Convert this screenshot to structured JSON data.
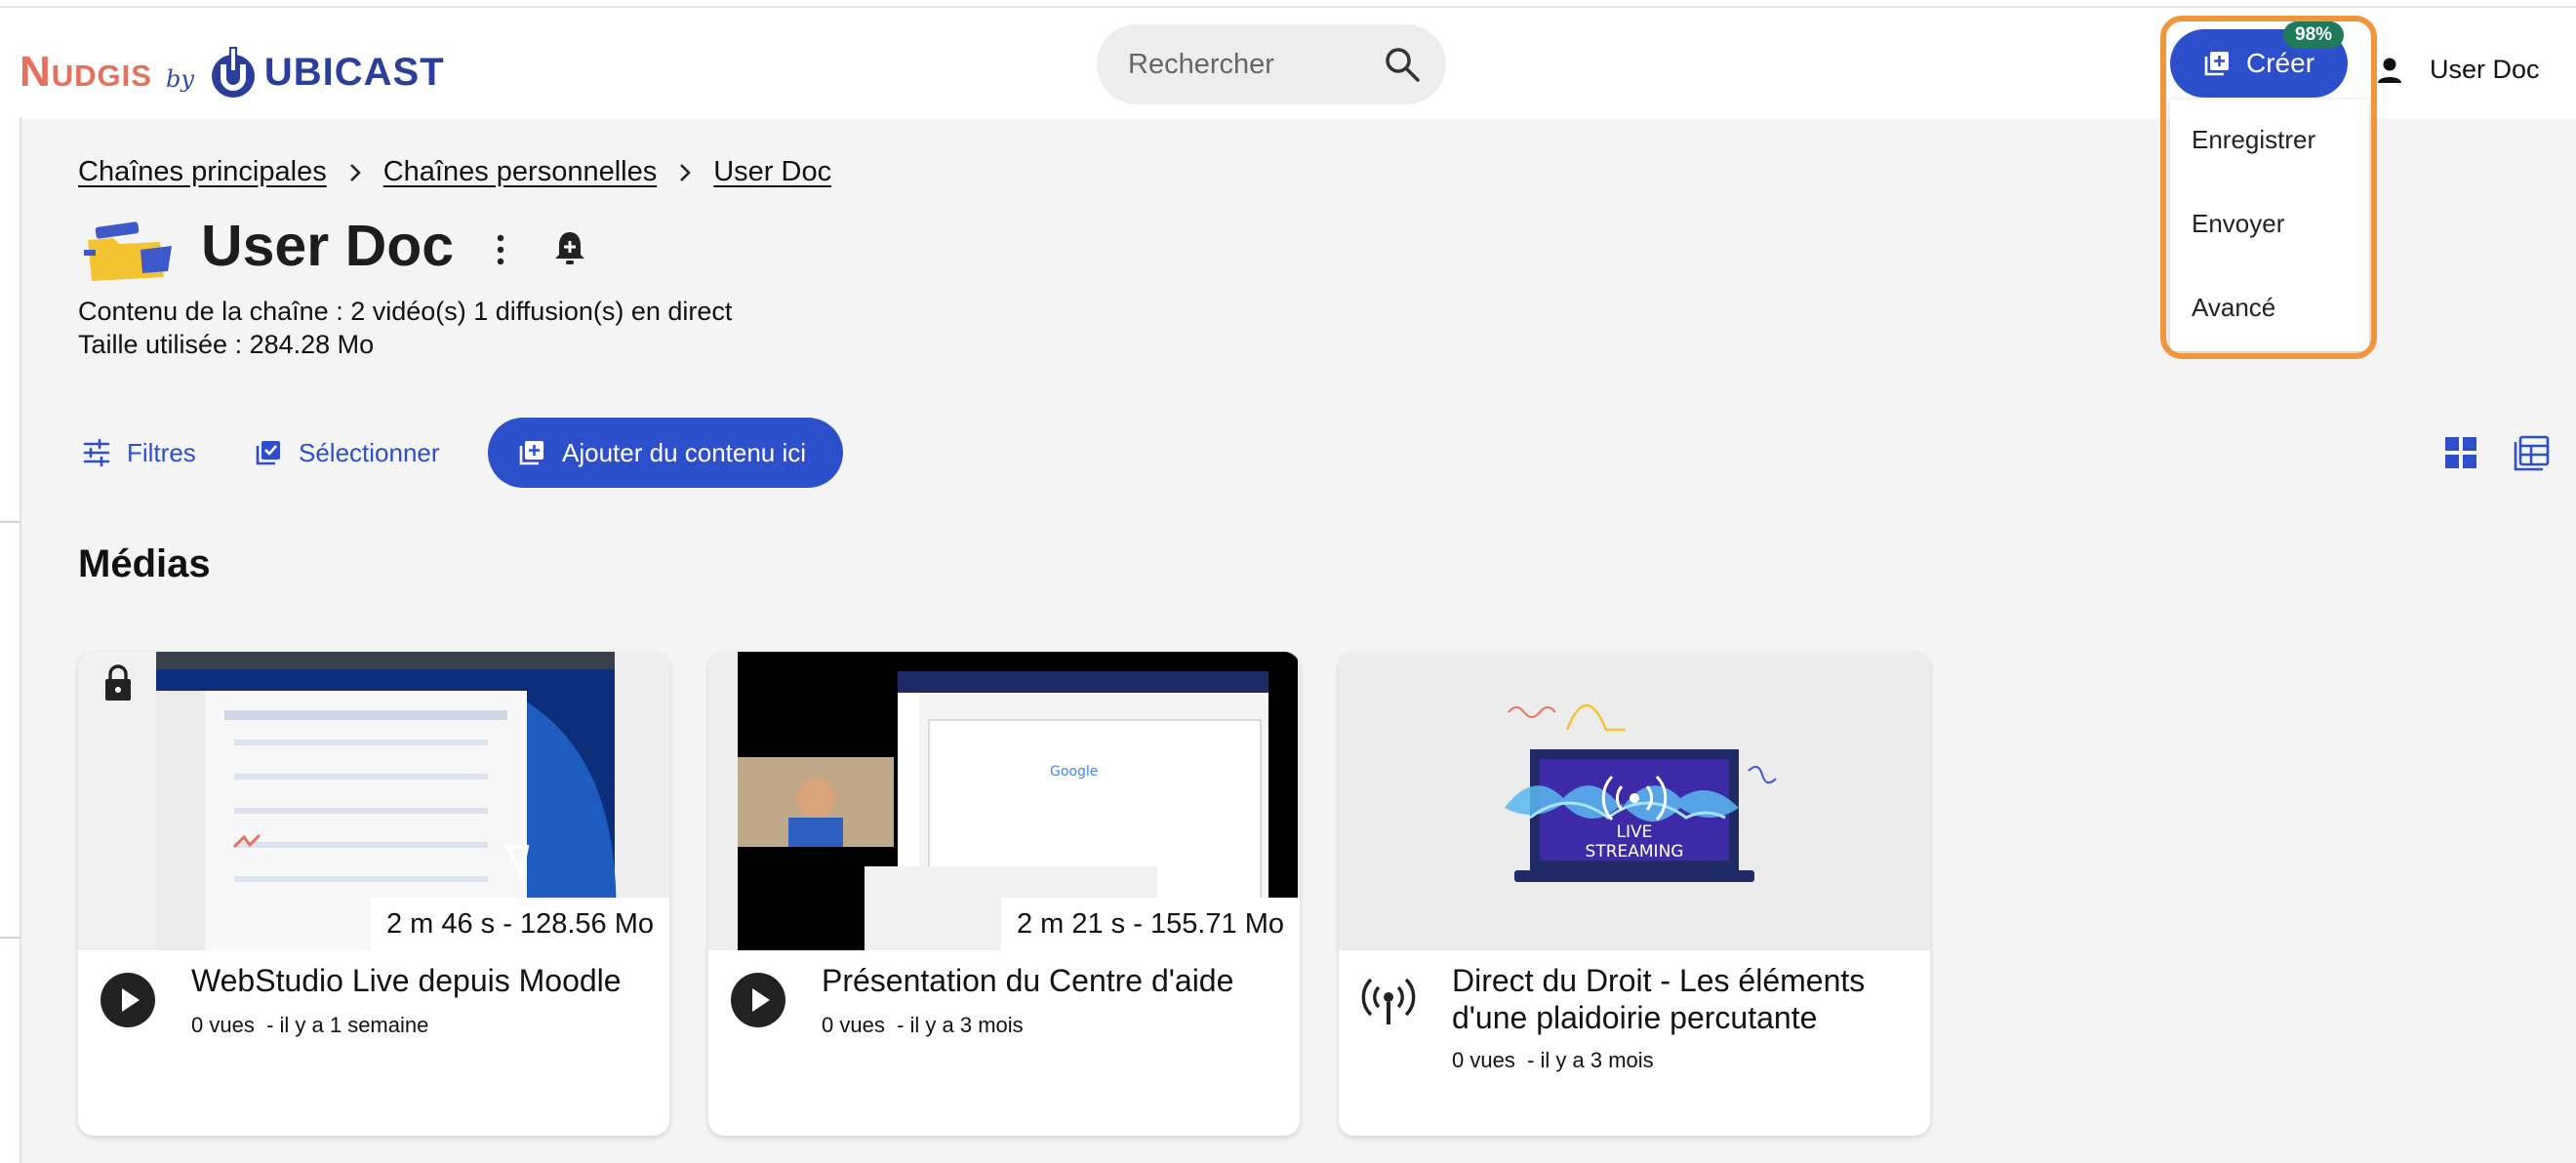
{
  "header": {
    "logo": {
      "brand": "Nudgis",
      "by": "by",
      "partner": "UBICAST"
    },
    "search": {
      "placeholder": "Rechercher"
    },
    "create": {
      "label": "Créer",
      "badge": "98%",
      "menu": [
        "Enregistrer",
        "Envoyer",
        "Avancé"
      ]
    },
    "user": {
      "name": "User Doc"
    }
  },
  "breadcrumbs": [
    "Chaînes principales",
    "Chaînes personnelles",
    "User Doc"
  ],
  "channel": {
    "title": "User Doc",
    "content_line": "Contenu de la chaîne : 2 vidéo(s) 1 diffusion(s) en direct",
    "size_line": "Taille utilisée : 284.28 Mo"
  },
  "toolbar": {
    "filters": "Filtres",
    "select": "Sélectionner",
    "add": "Ajouter du contenu ici"
  },
  "section": {
    "title": "Médias"
  },
  "cards": [
    {
      "title": "WebStudio Live depuis Moodle",
      "duration": "2 m 46 s - 128.56 Mo",
      "views": "0 vues",
      "date": "- il y a 1 semaine",
      "locked": true,
      "icon": "play-icon"
    },
    {
      "title": "Présentation du Centre d'aide",
      "duration": "2 m 21 s - 155.71 Mo",
      "views": "0 vues",
      "date": "- il y a 3 mois",
      "icon": "play-icon"
    },
    {
      "title": "Direct du Droit - Les éléments d'une plaidoirie percutante",
      "views": "0 vues",
      "date": "- il y a 3 mois",
      "thumb_text": "LIVE STREAMING",
      "icon": "live-icon"
    }
  ],
  "colors": {
    "primary": "#2d4fcc",
    "highlight": "#f0963a",
    "badge": "#1e7a5a",
    "logo_red": "#e8705a"
  }
}
